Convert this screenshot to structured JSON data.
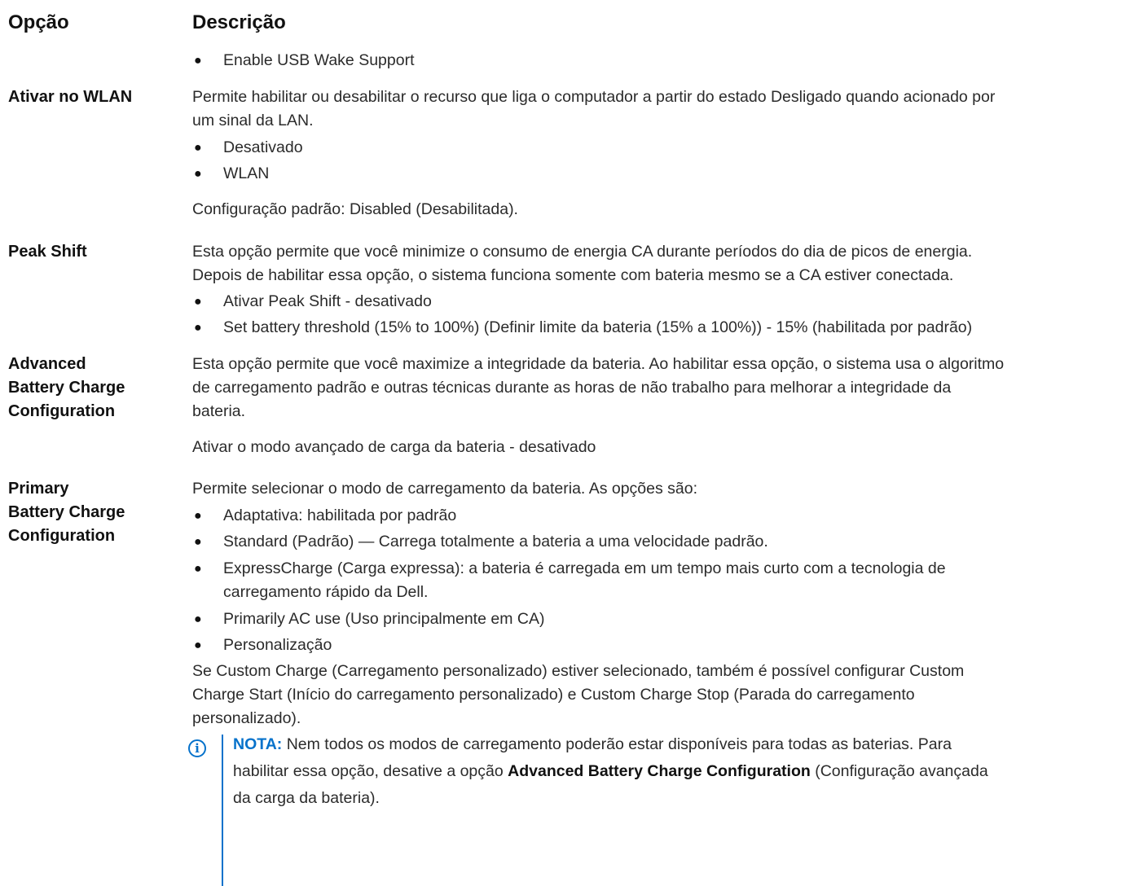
{
  "header": {
    "option": "Opção",
    "description": "Descrição"
  },
  "rows": [
    {
      "bullets_top": [
        "Enable USB Wake Support"
      ]
    },
    {
      "label": "Ativar no WLAN",
      "desc_line1": "Permite habilitar ou desabilitar o recurso que liga o computador a partir do estado Desligado quando acionado por",
      "desc_line2": "um sinal da LAN.",
      "bullets": [
        "Desativado",
        "WLAN"
      ],
      "default": "Configuração padrão: Disabled (Desabilitada)."
    },
    {
      "label": "Peak Shift",
      "desc_line1": "Esta opção permite que você minimize o consumo de energia CA durante períodos do dia de picos de energia.",
      "desc_line2": "Depois de habilitar essa opção, o sistema funciona somente com bateria mesmo se a CA estiver conectada.",
      "bullets": [
        "Ativar Peak Shift - desativado",
        "Set battery threshold (15% to 100%) (Definir limite da bateria (15% a 100%)) - 15% (habilitada por padrão)"
      ]
    },
    {
      "label_lines": [
        "Advanced",
        "Battery Charge",
        "Configuration"
      ],
      "desc_lines": [
        "Esta opção permite que você maximize a integridade da bateria. Ao habilitar essa opção, o sistema usa o algoritmo",
        "de carregamento padrão e outras técnicas durante as horas de não trabalho para melhorar a integridade da",
        "bateria."
      ],
      "extra": "Ativar o modo avançado de carga da bateria - desativado"
    },
    {
      "label_lines": [
        "Primary",
        "Battery Charge",
        "Configuration"
      ],
      "desc": "Permite selecionar o modo de carregamento da bateria. As opções são:",
      "bullets": [
        "Adaptativa: habilitada por padrão",
        "Standard (Padrão) — Carrega totalmente a bateria a uma velocidade padrão.",
        "ExpressCharge (Carga expressa): a bateria é carregada em um tempo mais curto com a tecnologia de",
        "carregamento rápido da Dell.",
        "Primarily AC use (Uso principalmente em CA)",
        "Personalização"
      ],
      "after_lines": [
        "Se Custom Charge (Carregamento personalizado) estiver selecionado, também é possível configurar Custom",
        "Charge Start (Início do carregamento personalizado) e Custom Charge Stop (Parada do carregamento",
        "personalizado)."
      ],
      "note": {
        "icon": "info-icon",
        "nota_label": "NOTA:",
        "line1_rest": " Nem todos os modos de carregamento poderão estar disponíveis para todas as baterias. Para",
        "line2_pre": "habilitar essa opção, desative a opção ",
        "line2_bold": "Advanced Battery Charge Configuration",
        "line2_post": " (Configuração avançada",
        "line3": "da carga da bateria)."
      }
    }
  ]
}
